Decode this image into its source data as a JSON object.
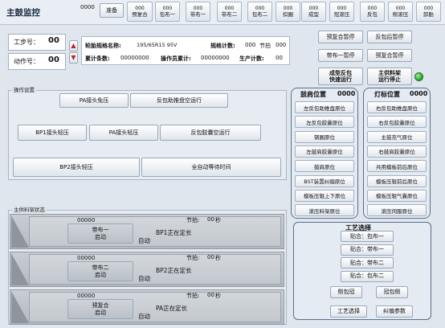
{
  "header": {
    "title": "主鼓监控",
    "counter": "0000",
    "ready": "准备",
    "tabs": [
      {
        "value": "000",
        "label": "预复合"
      },
      {
        "value": "000",
        "label": "包布一"
      },
      {
        "value": "000",
        "label": "带布一"
      },
      {
        "value": "000",
        "label": "带布二"
      },
      {
        "value": "000",
        "label": "包布二"
      },
      {
        "value": "000",
        "label": "扣圈"
      },
      {
        "value": "000",
        "label": "成型"
      },
      {
        "value": "000",
        "label": "冠滚压"
      },
      {
        "value": "000",
        "label": "反包"
      },
      {
        "value": "000",
        "label": "侧滚压"
      },
      {
        "value": "000",
        "label": "卸胎"
      }
    ]
  },
  "step": {
    "label": "工步号：",
    "value": "00"
  },
  "action": {
    "label": "动作号：",
    "value": "00"
  },
  "info": {
    "spec_label": "轮胎规格名称:",
    "spec_value": "195/65R15 95V",
    "spec_count_label": "规格计数:",
    "spec_count_value": "000",
    "cycle_label": "节拍",
    "cycle_value": "000",
    "total_label": "累计条数:",
    "total_value": "00000000",
    "operator_total_label": "操作员累计:",
    "operator_total_value": "00000000",
    "prod_count_label": "生产计数:",
    "prod_count_value": "00"
  },
  "control_buttons": {
    "pre_pause": "预复合暂停",
    "turnup_pause": "反包后暂停",
    "ply1_pause": "带布一暂停",
    "pre_pause2": "预复合暂停",
    "fast_run": "成型反包\n快速运行",
    "stop_feed": "主供料架\n运行停止"
  },
  "ops": {
    "title": "操作设置",
    "pa_press": "PA接头免压",
    "turnup_push": "反包助推盘空运行",
    "bp1_light": "BP1接头轻压",
    "pa_light": "PA接头轻压",
    "turnup_bladder": "反包胶囊空运行",
    "bp2_light": "BP2接头轻压",
    "auto_wait": "全自动等待时间"
  },
  "shoulder": {
    "title": "鼓肩位置",
    "value": "0000",
    "items": [
      "左反包助推盘原位",
      "左反包胶囊原位",
      "钢圈原位",
      "左鼓肩胶囊原位",
      "鼓肩原位",
      "BST装置纠偏原位",
      "模板压辊上下原位",
      "滚压料架原位"
    ]
  },
  "lamp": {
    "title": "灯标位置",
    "value": "0000",
    "items": [
      "右反包助推盘原位",
      "右反包胶囊原位",
      "主鼓充气原位",
      "右鼓肩胶囊原位",
      "共用模板前后原位",
      "模板压辊前后原位",
      "模板压辊气囊原位",
      "滚压伺服原位"
    ]
  },
  "feed": {
    "title": "主供料架状态",
    "rows": [
      {
        "counter": "00000",
        "name": "带布一",
        "state": "启动",
        "beat_label": "节拍:",
        "beat_value": "00",
        "unit": "秒",
        "msg": "BP1正在定长",
        "auto": "自动"
      },
      {
        "counter": "00000",
        "name": "带布二",
        "state": "启动",
        "beat_label": "节拍:",
        "beat_value": "00",
        "unit": "秒",
        "msg": "BP2正在定长",
        "auto": "自动"
      },
      {
        "counter": "00000",
        "name": "预复合",
        "state": "启动",
        "beat_label": "节拍:",
        "beat_value": "00",
        "unit": "秒",
        "msg": "PA正在定长",
        "auto": "自动"
      }
    ]
  },
  "process": {
    "title": "工艺选择",
    "items": [
      "贴合：包布一",
      "贴合：带布一",
      "贴合：带布二",
      "贴合：包布二"
    ],
    "btn_a": "侧包冠",
    "btn_b": "冠包侧",
    "btn_c": "工艺选择",
    "btn_d": "纠偏参数"
  },
  "colors": {
    "indicator_green": "#22b82a",
    "arrow_red": "#c81e1e",
    "frame_blue": "#5d6f86"
  }
}
